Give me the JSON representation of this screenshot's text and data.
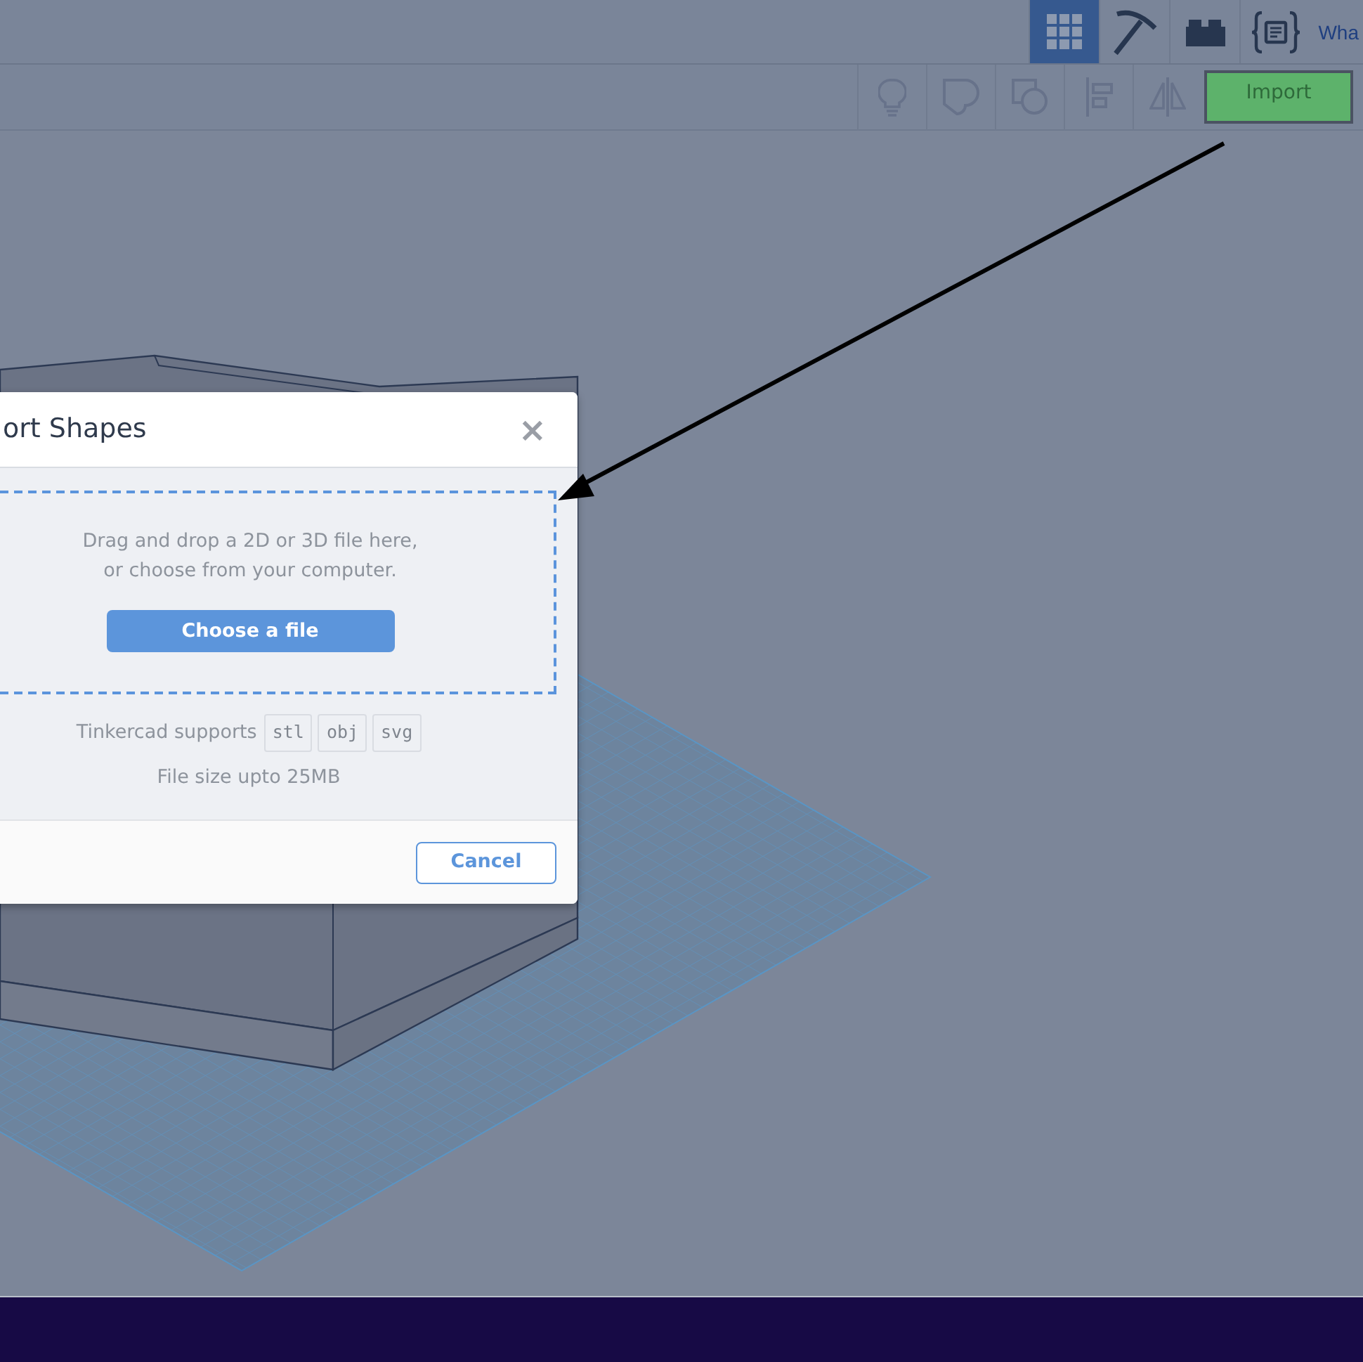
{
  "top_bar": {
    "view_tabs": [
      {
        "kind": "grid",
        "selected": true
      },
      {
        "kind": "pickaxe",
        "selected": false
      },
      {
        "kind": "brick",
        "selected": false
      },
      {
        "kind": "code",
        "selected": false
      }
    ],
    "link": "Wha"
  },
  "toolbar": {
    "tools": [
      {
        "kind": "bulb"
      },
      {
        "kind": "shape"
      },
      {
        "kind": "hole"
      },
      {
        "kind": "align"
      },
      {
        "kind": "mirror"
      }
    ],
    "import_button": "Import"
  },
  "modal": {
    "title": "ort Shapes",
    "close": "×",
    "drop_hint": [
      "Drag and drop a 2D or 3D file here,",
      "or choose from your computer."
    ],
    "choose_button": "Choose a file",
    "supports_label": "Tinkercad supports",
    "formats": [
      "stl",
      "obj",
      "svg"
    ],
    "size_note": "File size upto 25MB",
    "cancel_button": "Cancel"
  }
}
